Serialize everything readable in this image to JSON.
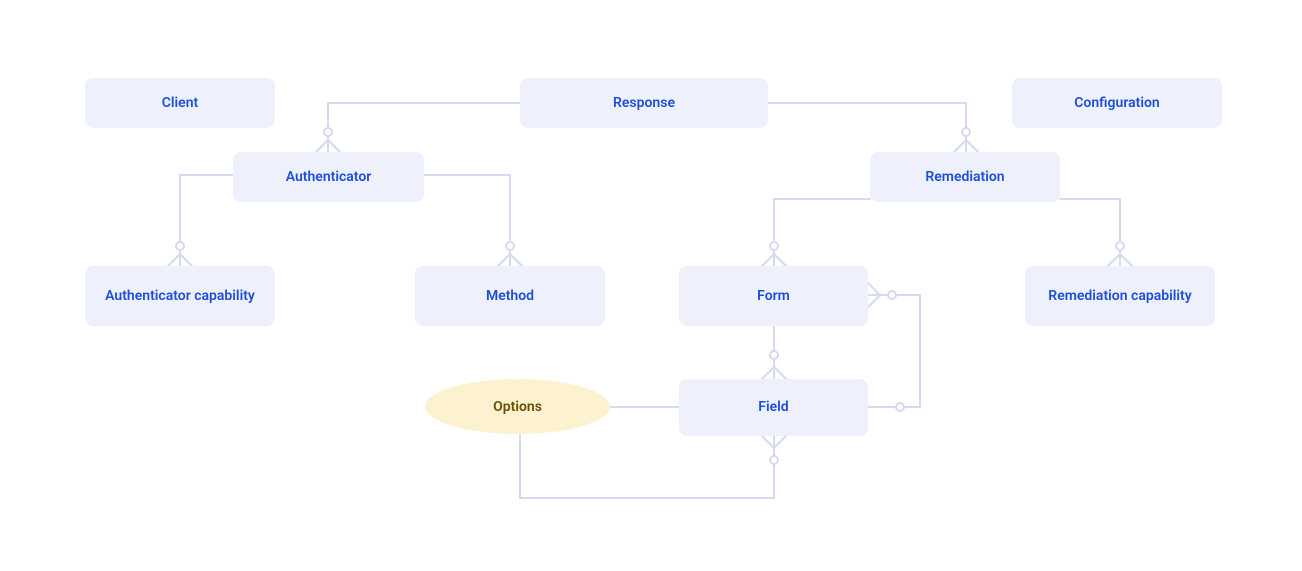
{
  "nodes": {
    "client": {
      "label": "Client"
    },
    "response": {
      "label": "Response"
    },
    "configuration": {
      "label": "Configuration"
    },
    "authenticator": {
      "label": "Authenticator"
    },
    "remediation": {
      "label": "Remediation"
    },
    "authenticator_capability": {
      "label": "Authenticator capability"
    },
    "method": {
      "label": "Method"
    },
    "form": {
      "label": "Form"
    },
    "remediation_capability": {
      "label": "Remediation capability"
    },
    "field": {
      "label": "Field"
    },
    "options": {
      "label": "Options"
    }
  },
  "colors": {
    "node_bg": "#eef1fc",
    "node_text": "#1d4ed8",
    "ellipse_bg": "#fcf2d0",
    "ellipse_text": "#6b4e00",
    "connector": "#d6d9f0"
  },
  "edges": [
    [
      "response",
      "authenticator"
    ],
    [
      "response",
      "remediation"
    ],
    [
      "authenticator",
      "authenticator_capability"
    ],
    [
      "authenticator",
      "method"
    ],
    [
      "remediation",
      "form"
    ],
    [
      "remediation",
      "remediation_capability"
    ],
    [
      "form",
      "field"
    ],
    [
      "field",
      "form"
    ],
    [
      "field",
      "options"
    ],
    [
      "field",
      "field"
    ]
  ]
}
